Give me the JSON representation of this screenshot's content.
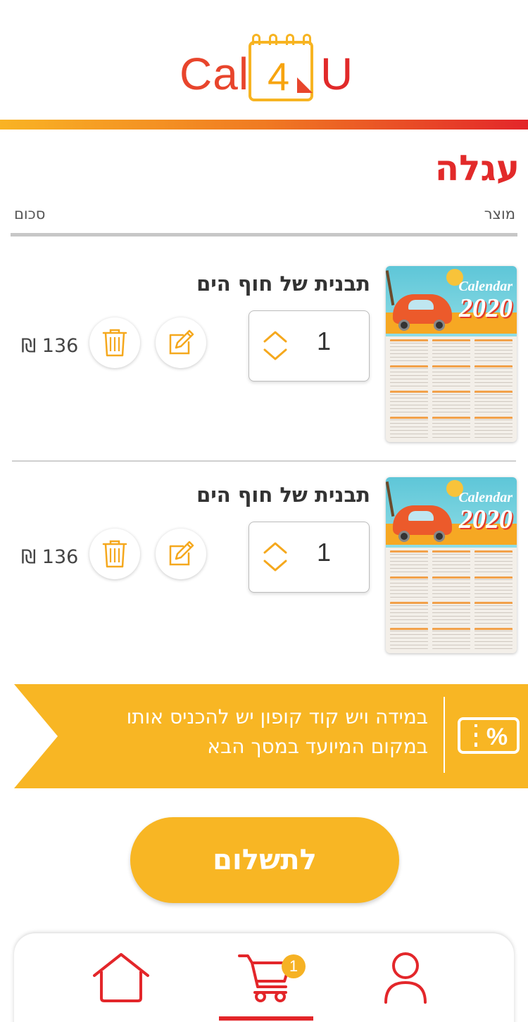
{
  "header": {
    "logo": {
      "part1": "Cal",
      "part2": "4",
      "part3": "U"
    }
  },
  "page": {
    "title": "עגלה",
    "columns": {
      "product": "מוצר",
      "sum": "סכום"
    }
  },
  "cart_items": [
    {
      "title": "תבנית של חוף הים",
      "quantity": "1",
      "price": "136 ₪",
      "thumbnail": {
        "brand": "Calendar",
        "year": "2020"
      }
    },
    {
      "title": "תבנית של חוף הים",
      "quantity": "1",
      "price": "136 ₪",
      "thumbnail": {
        "brand": "Calendar",
        "year": "2020"
      }
    }
  ],
  "coupon": {
    "line1": "במידה ויש קוד קופון יש להכניס אותו",
    "line2": "במקום המיועד במסך הבא",
    "icon": "percent-ticket-icon"
  },
  "pay_button": {
    "label": "לתשלום"
  },
  "bottom_nav": {
    "items": [
      {
        "name": "home",
        "icon": "home-icon"
      },
      {
        "name": "cart",
        "icon": "cart-icon",
        "badge": "1",
        "active": true
      },
      {
        "name": "profile",
        "icon": "user-icon"
      }
    ]
  },
  "colors": {
    "brand_red": "#e22a2a",
    "brand_yellow": "#f8b624",
    "accent_orange": "#f07a22"
  }
}
